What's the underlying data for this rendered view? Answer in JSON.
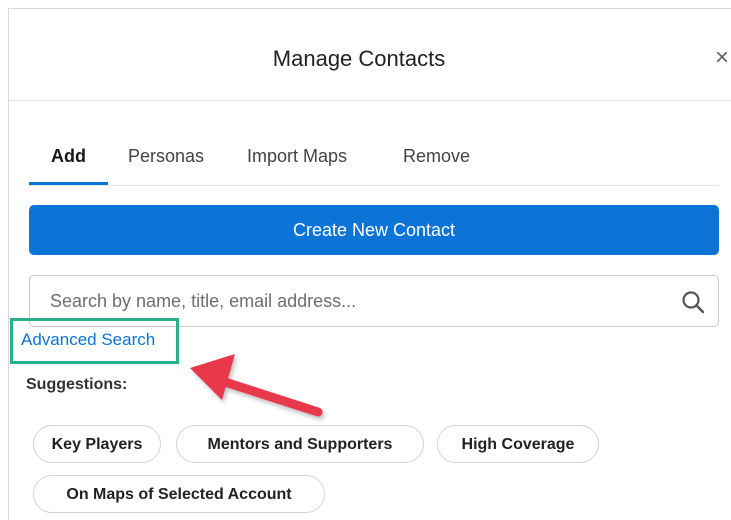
{
  "modal": {
    "title": "Manage Contacts",
    "close_symbol": "×"
  },
  "tabs": [
    {
      "label": "Add",
      "active": true
    },
    {
      "label": "Personas",
      "active": false
    },
    {
      "label": "Import Maps",
      "active": false
    },
    {
      "label": "Remove",
      "active": false
    }
  ],
  "create_button": {
    "label": "Create New Contact"
  },
  "search": {
    "placeholder": "Search by name, title, email address...",
    "value": "",
    "icon": "search-icon"
  },
  "advanced_search": {
    "label": "Advanced Search"
  },
  "suggestions": {
    "label": "Suggestions:",
    "chips": [
      "Key Players",
      "Mentors and Supporters",
      "High Coverage",
      "On Maps of Selected Account"
    ]
  },
  "colors": {
    "primary": "#0b74d6",
    "highlight": "#27b08b",
    "arrow": "#e8394a"
  }
}
